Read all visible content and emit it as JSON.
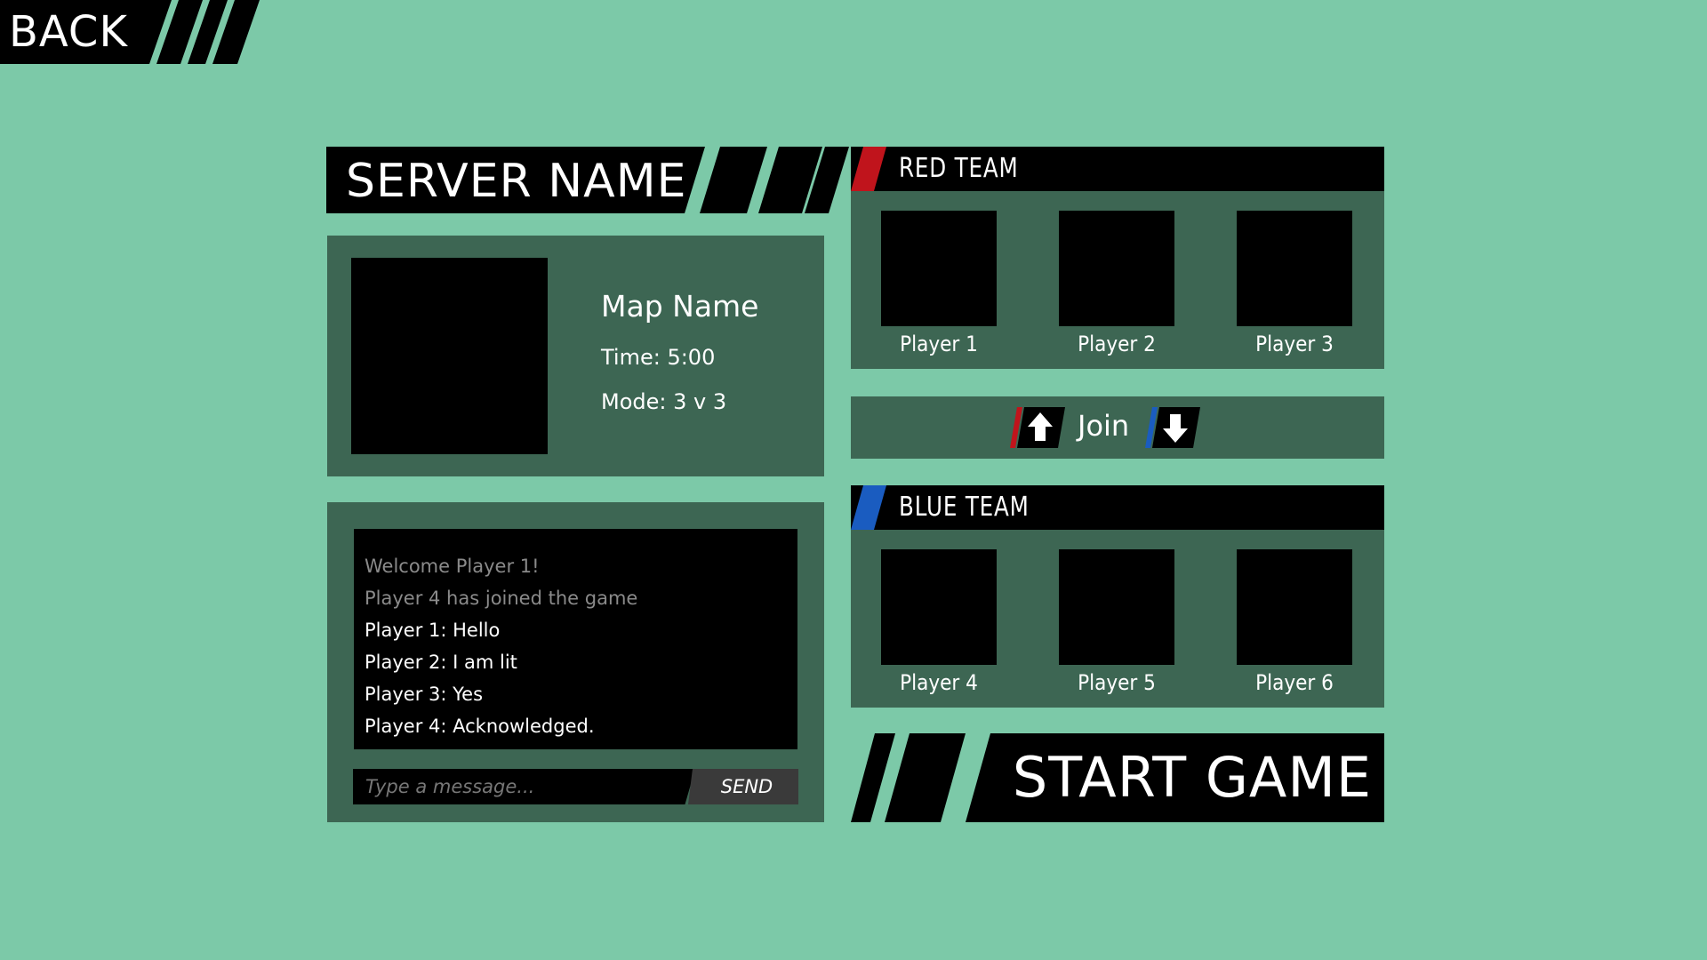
{
  "back": {
    "label": "BACK"
  },
  "server": {
    "name": "SERVER NAME"
  },
  "map": {
    "name": "Map Name",
    "time": "Time: 5:00",
    "mode": "Mode: 3 v 3"
  },
  "chat": {
    "messages": [
      {
        "text": "Welcome Player 1!",
        "system": true
      },
      {
        "text": "Player 4 has joined the game",
        "system": true
      },
      {
        "text": "Player 1: Hello",
        "system": false
      },
      {
        "text": "Player 2: I am lit",
        "system": false
      },
      {
        "text": "Player 3: Yes",
        "system": false
      },
      {
        "text": "Player 4: Acknowledged.",
        "system": false
      }
    ],
    "placeholder": "Type a message...",
    "send_label": "SEND"
  },
  "red_team": {
    "title": "RED TEAM",
    "color": "#c0141c",
    "players": [
      "Player 1",
      "Player 2",
      "Player 3"
    ]
  },
  "join": {
    "label": "Join",
    "up_icon": "arrow-up-icon",
    "down_icon": "arrow-down-icon"
  },
  "blue_team": {
    "title": "BLUE TEAM",
    "color": "#1a5cc0",
    "players": [
      "Player 4",
      "Player 5",
      "Player 6"
    ]
  },
  "start": {
    "label": "START GAME"
  },
  "colors": {
    "background": "#7cc9a8",
    "panel": "#3d6653",
    "black": "#000000"
  }
}
